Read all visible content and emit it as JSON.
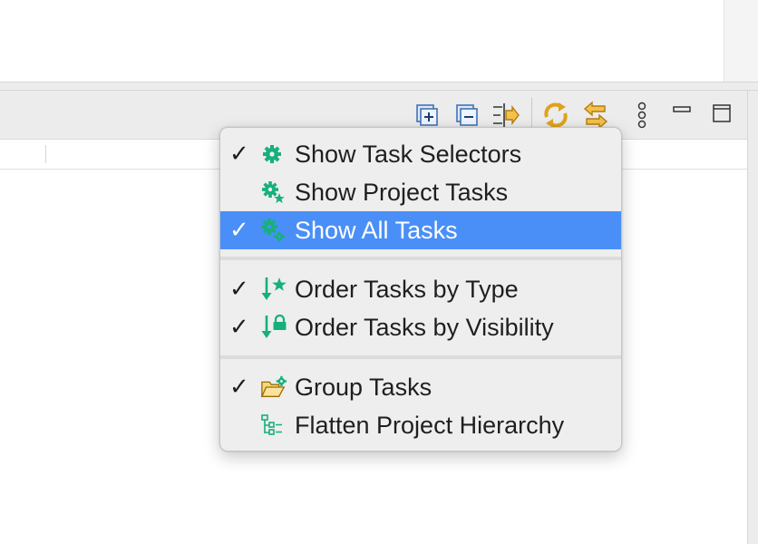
{
  "toolbar": {
    "buttons": [
      {
        "name": "expand-all-icon"
      },
      {
        "name": "collapse-all-icon"
      },
      {
        "name": "link-with-editor-icon"
      },
      {
        "name": "refresh-icon"
      },
      {
        "name": "sync-icon"
      },
      {
        "name": "view-menu-icon"
      },
      {
        "name": "minimize-icon"
      },
      {
        "name": "maximize-icon"
      }
    ]
  },
  "menu": {
    "items": [
      {
        "label": "Show Task Selectors",
        "checked": true,
        "icon": "gear-icon",
        "selected": false
      },
      {
        "label": "Show Project Tasks",
        "checked": false,
        "icon": "gear-star-icon",
        "selected": false
      },
      {
        "label": "Show All Tasks",
        "checked": true,
        "icon": "gears-icon",
        "selected": true
      },
      {
        "label": "Order Tasks by Type",
        "checked": true,
        "icon": "sort-star-icon",
        "selected": false
      },
      {
        "label": "Order Tasks by Visibility",
        "checked": true,
        "icon": "sort-lock-icon",
        "selected": false
      },
      {
        "label": "Group Tasks",
        "checked": true,
        "icon": "folder-gear-icon",
        "selected": false
      },
      {
        "label": "Flatten Project Hierarchy",
        "checked": false,
        "icon": "hierarchy-icon",
        "selected": false
      }
    ],
    "check_glyph": "✓"
  },
  "colors": {
    "accent": "#4a8ff7",
    "icon_green": "#17b07a",
    "icon_orange": "#e0a21b",
    "icon_blue": "#3f73b8"
  }
}
